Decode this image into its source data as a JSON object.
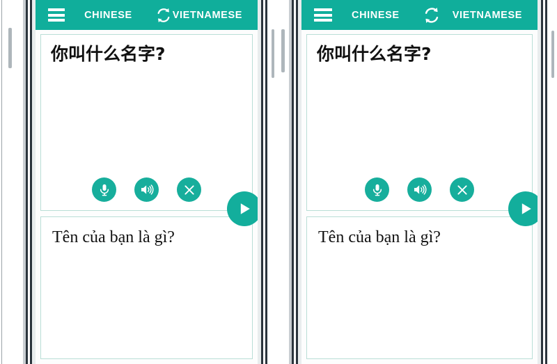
{
  "app": {
    "accent_color": "#10AE9B",
    "button_color": "#17AE9C",
    "panel_border_color": "#b9ded6",
    "background_color": "#ffffff"
  },
  "header": {
    "menu_icon": "hamburger-menu-icon",
    "source_language": "CHINESE",
    "swap_icon": "swap-languages-icon",
    "target_language": "VIETNAMESE"
  },
  "source_panel": {
    "text": "你叫什么名字?",
    "actions": [
      {
        "name": "microphone-button",
        "icon": "microphone-icon"
      },
      {
        "name": "speak-button",
        "icon": "speaker-icon"
      },
      {
        "name": "clear-button",
        "icon": "close-icon"
      }
    ]
  },
  "send_button": {
    "name": "send-button",
    "icon": "send-arrow-icon"
  },
  "target_panel": {
    "text": "Tên của bạn là gì?"
  },
  "devices": [
    {
      "id": "phone-left"
    },
    {
      "id": "phone-right"
    }
  ]
}
